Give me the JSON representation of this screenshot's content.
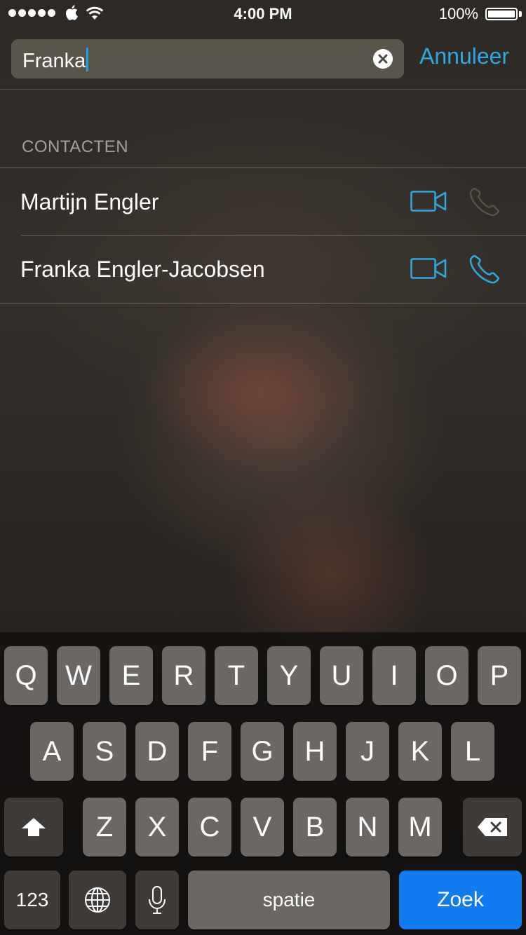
{
  "status_bar": {
    "time": "4:00 PM",
    "battery_percent": "100%",
    "signal_dots": 5,
    "icons": [
      "apple-icon",
      "wifi-icon",
      "battery-icon"
    ]
  },
  "search": {
    "query": "Franka",
    "cancel_label": "Annuleer"
  },
  "section": {
    "title": "CONTACTEN"
  },
  "contacts": [
    {
      "name": "Martijn Engler",
      "phone_enabled": false
    },
    {
      "name": "Franka Engler-Jacobsen",
      "phone_enabled": true
    }
  ],
  "keyboard": {
    "row1": [
      "Q",
      "W",
      "E",
      "R",
      "T",
      "Y",
      "U",
      "I",
      "O",
      "P"
    ],
    "row2": [
      "A",
      "S",
      "D",
      "F",
      "G",
      "H",
      "J",
      "K",
      "L"
    ],
    "row3": [
      "Z",
      "X",
      "C",
      "V",
      "B",
      "N",
      "M"
    ],
    "numbers_label": "123",
    "space_label": "spatie",
    "action_label": "Zoek"
  },
  "colors": {
    "accent": "#2fa8e3",
    "action_key": "#117cf2",
    "disabled_icon": "#5a5449"
  }
}
